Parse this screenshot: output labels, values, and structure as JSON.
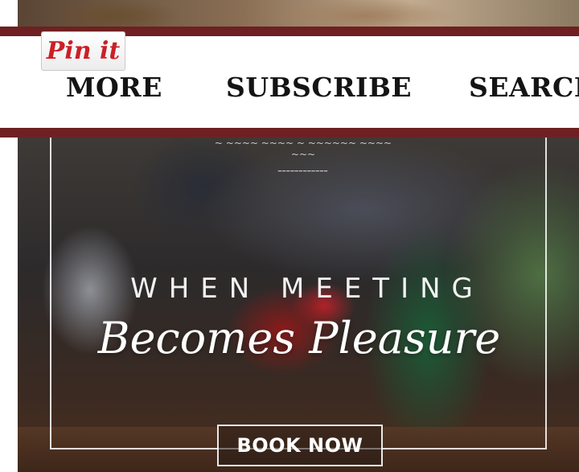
{
  "nav": {
    "items": [
      {
        "label": "MORE"
      },
      {
        "label": "SUBSCRIBE"
      },
      {
        "label": "SEARCH"
      }
    ],
    "pin_button": {
      "label": "Pin it"
    }
  },
  "hero": {
    "headline": "WHEN MEETING",
    "script_text": "Becomes Pleasure",
    "cta_label": "BOOK NOW"
  },
  "colors": {
    "nav_border": "#6e2022",
    "pin_red": "#cb2027"
  }
}
